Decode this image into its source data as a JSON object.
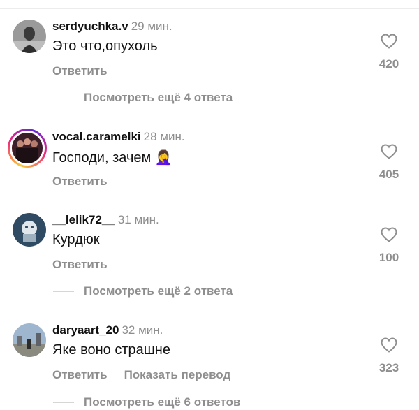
{
  "comments": [
    {
      "username": "serdyuchka.v",
      "time": "29 мин.",
      "text": "Это что,опухоль",
      "reply_label": "Ответить",
      "likes": "420",
      "more_replies": "Посмотреть ещё 4 ответа"
    },
    {
      "username": "vocal.caramelki",
      "time": "28 мин.",
      "text": "Господи, зачем 🤦‍♀️",
      "reply_label": "Ответить",
      "likes": "405"
    },
    {
      "username": "__lelik72__",
      "time": "31 мин.",
      "text": "Курдюк",
      "reply_label": "Ответить",
      "likes": "100",
      "more_replies": "Посмотреть ещё 2 ответа"
    },
    {
      "username": "daryaart_20",
      "time": "32 мин.",
      "text": "Яке воно страшне",
      "reply_label": "Ответить",
      "translate_label": "Показать перевод",
      "likes": "323",
      "more_replies": "Посмотреть ещё 6 ответов"
    }
  ]
}
